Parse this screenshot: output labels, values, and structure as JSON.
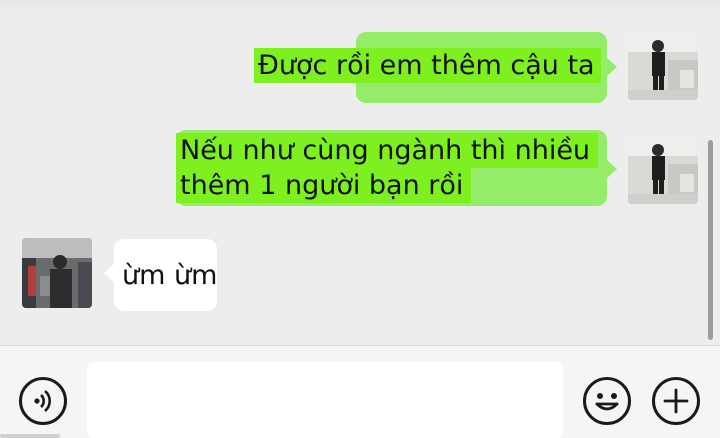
{
  "messages": [
    {
      "direction": "outgoing",
      "lines": [
        "Được rồi em thêm cậu ta"
      ],
      "avatar": "avatar-self"
    },
    {
      "direction": "outgoing",
      "lines": [
        "Nếu như cùng ngành thì nhiều",
        "thêm 1 người bạn rồi"
      ],
      "avatar": "avatar-self"
    },
    {
      "direction": "incoming",
      "lines": [
        "ừm ừm"
      ],
      "avatar": "avatar-contact"
    }
  ],
  "input": {
    "value": "",
    "placeholder": ""
  },
  "icons": {
    "voice": "voice-icon",
    "emoji": "emoji-icon",
    "more": "plus-icon"
  },
  "colors": {
    "outgoing_bubble": "#95ec69",
    "outgoing_highlight": "#7ef01f",
    "incoming_bubble": "#ffffff",
    "background": "#ededed"
  }
}
